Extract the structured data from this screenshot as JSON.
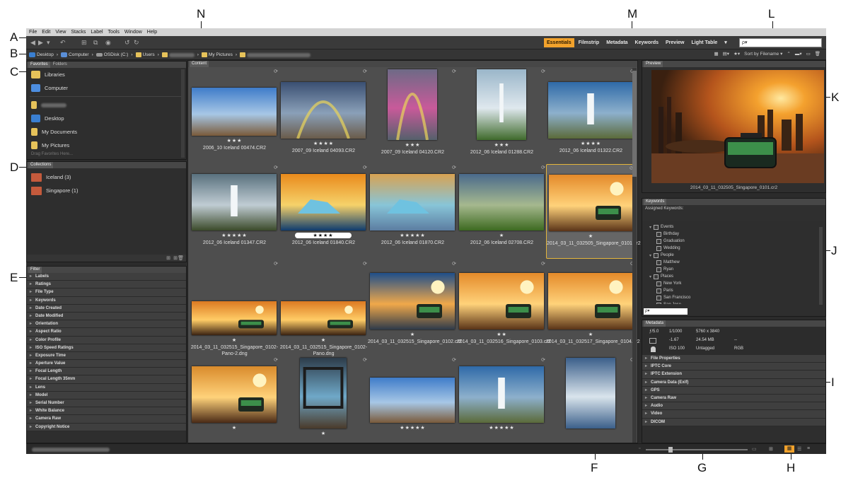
{
  "callouts": {
    "A": "A",
    "B": "B",
    "C": "C",
    "D": "D",
    "E": "E",
    "F": "F",
    "G": "G",
    "H": "H",
    "I": "I",
    "J": "J",
    "K": "K",
    "L": "L",
    "M": "M",
    "N": "N"
  },
  "menu": [
    "File",
    "Edit",
    "View",
    "Stacks",
    "Label",
    "Tools",
    "Window",
    "Help"
  ],
  "workspaces": {
    "essentials": "Essentials",
    "filmstrip": "Filmstrip",
    "metadata": "Metadata",
    "keywords": "Keywords",
    "preview": "Preview",
    "lighttable": "Light Table"
  },
  "search": {
    "placeholder": "ρ▾"
  },
  "breadcrumb": {
    "desktop": "Desktop",
    "computer": "Computer",
    "osdisk": "OSDisk (C:)",
    "users": "Users",
    "mypictures": "My Pictures"
  },
  "sort": {
    "label": "Sort by Filename ▾"
  },
  "left_panel": {
    "tabs": [
      "Favorites",
      "Folders"
    ],
    "favorites": [
      "Libraries",
      "Computer",
      "",
      "Desktop",
      "My Documents",
      "My Pictures"
    ],
    "drag_hint": "Drag Favorites Here...",
    "collections_tab": "Collections",
    "collections": [
      "Iceland (3)",
      "Singapore (1)"
    ],
    "filter_tab": "Filter",
    "filters": [
      "Labels",
      "Ratings",
      "File Type",
      "Keywords",
      "Date Created",
      "Date Modified",
      "Orientation",
      "Aspect Ratio",
      "Color Profile",
      "ISO Speed Ratings",
      "Exposure Time",
      "Aperture Value",
      "Focal Length",
      "Focal Length 35mm",
      "Lens",
      "Model",
      "Serial Number",
      "White Balance",
      "Camera Raw",
      "Copyright Notice"
    ]
  },
  "content": {
    "tab": "Content",
    "items": [
      {
        "name": "2006_10 Iceland 00474.CR2",
        "stars": "★★★",
        "theme": "iceland-sky"
      },
      {
        "name": "2007_09 Iceland 04093.CR2",
        "stars": "★★★★",
        "theme": "rainbow-field"
      },
      {
        "name": "2007_09 Iceland 04120.CR2",
        "stars": "★★★",
        "theme": "rainbow"
      },
      {
        "name": "2012_06 Iceland 01288.CR2",
        "stars": "★★★",
        "theme": "waterfall"
      },
      {
        "name": "2012_06 Iceland 01322.CR2",
        "stars": "★★★★",
        "theme": "waterfall-wide"
      },
      {
        "name": "2012_06 Iceland 01347.CR2",
        "stars": "★★★★★",
        "theme": "waterfall-dark"
      },
      {
        "name": "2012_06 Iceland 01840.CR2",
        "stars": "★★★★",
        "theme": "iceberg-sunset"
      },
      {
        "name": "2012_06 Iceland 01870.CR2",
        "stars": "★★★★★",
        "theme": "iceberg"
      },
      {
        "name": "2012_06 Iceland 02708.CR2",
        "stars": "★",
        "theme": "green-field"
      },
      {
        "name": "2014_03_11_032505_Singapore_0101.cr2",
        "stars": "★",
        "theme": "singapore"
      },
      {
        "name": "2014_03_11_032515_Singapore_0102-Pano-2.dng",
        "stars": "★",
        "theme": "pano"
      },
      {
        "name": "2014_03_11_032515_Singapore_0102-Pano.dng",
        "stars": "★",
        "theme": "pano"
      },
      {
        "name": "2014_03_11_032515_Singapore_0102.cr2",
        "stars": "★",
        "theme": "singapore-blue"
      },
      {
        "name": "2014_03_11_032516_Singapore_0103.cr2",
        "stars": "★★",
        "theme": "singapore"
      },
      {
        "name": "2014_03_11_032517_Singapore_0104.cr2",
        "stars": "★",
        "theme": "singapore"
      },
      {
        "name": "",
        "stars": "★",
        "theme": "singapore-cab"
      },
      {
        "name": "",
        "stars": "★",
        "theme": "cabin"
      },
      {
        "name": "",
        "stars": "★★★★★",
        "theme": "iceland-sky"
      },
      {
        "name": "",
        "stars": "★★★★★",
        "theme": "waterfall-wide"
      },
      {
        "name": "",
        "stars": "",
        "theme": "reflection"
      }
    ]
  },
  "preview": {
    "tab": "Preview",
    "caption": "2014_03_11_032505_Singapore_0101.cr2"
  },
  "keywords": {
    "tab": "Keywords",
    "assigned": "Assigned Keywords:",
    "groups": [
      {
        "label": "Events",
        "items": [
          "Birthday",
          "Graduation",
          "Wedding"
        ]
      },
      {
        "label": "People",
        "items": [
          "Matthew",
          "Ryan"
        ]
      },
      {
        "label": "Places",
        "items": [
          "New York",
          "Paris",
          "San Francisco",
          "San Jose"
        ]
      }
    ]
  },
  "metadata": {
    "tab": "Metadata",
    "fstop": "ƒ/5.0",
    "shutter": "1/1000",
    "dims": "5760 x 3840",
    "ev": "-1.67",
    "size": "24.54 MB",
    "dash": "--",
    "iso": "ISO 100",
    "tag": "Untagged",
    "mode": "RGB",
    "sections": [
      "File Properties",
      "IPTC Core",
      "IPTC Extension",
      "Camera Data (Exif)",
      "GPS",
      "Camera Raw",
      "Audio",
      "Video",
      "DICOM"
    ]
  },
  "colors": {
    "accent": "#f2a22c",
    "selection": "#e3b53c"
  }
}
